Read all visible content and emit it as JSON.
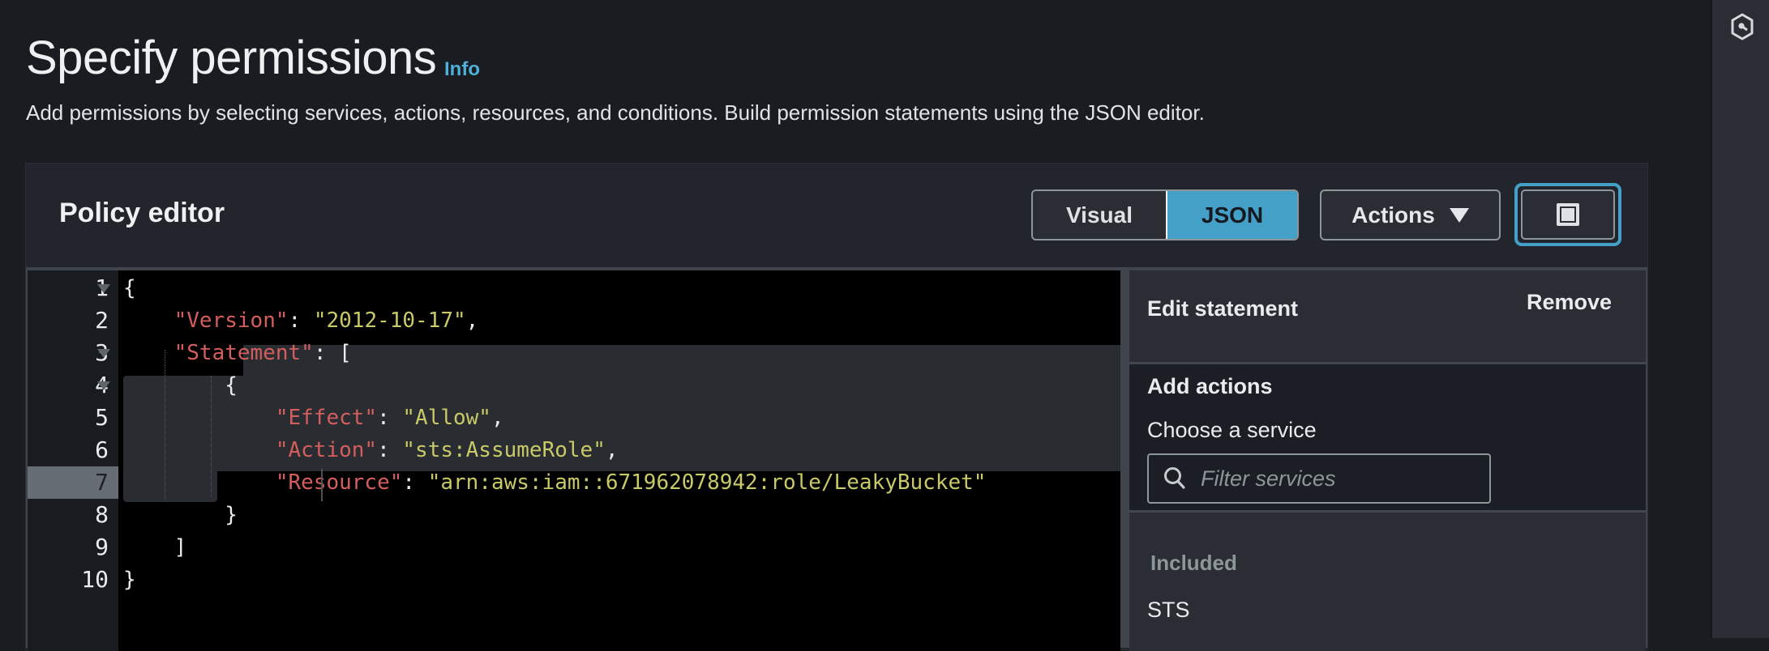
{
  "page": {
    "title": "Specify permissions",
    "info_link": "Info",
    "subtitle": "Add permissions by selecting services, actions, resources, and conditions. Build permission statements using the JSON editor."
  },
  "policy_editor": {
    "title": "Policy editor",
    "mode_toggle": {
      "options": [
        "Visual",
        "JSON"
      ],
      "selected": "JSON"
    },
    "actions_label": "Actions",
    "fullscreen_icon": "fullscreen-icon",
    "colors": {
      "accent": "#44a0c7",
      "json_key": "#d45e5e",
      "json_string": "#c9c968"
    }
  },
  "code_editor": {
    "active_line": 7,
    "line_numbers": [
      "1",
      "2",
      "3",
      "4",
      "5",
      "6",
      "7",
      "8",
      "9",
      "10"
    ],
    "lines": [
      {
        "indent": "",
        "tokens": [
          {
            "t": "p",
            "v": "{"
          }
        ]
      },
      {
        "indent": "    ",
        "tokens": [
          {
            "t": "k",
            "v": "\"Version\""
          },
          {
            "t": "p",
            "v": ": "
          },
          {
            "t": "s",
            "v": "\"2012-10-17\""
          },
          {
            "t": "p",
            "v": ","
          }
        ]
      },
      {
        "indent": "    ",
        "tokens": [
          {
            "t": "k",
            "v": "\"Statement\""
          },
          {
            "t": "p",
            "v": ": ["
          }
        ]
      },
      {
        "indent": "        ",
        "tokens": [
          {
            "t": "p",
            "v": "{"
          }
        ]
      },
      {
        "indent": "            ",
        "tokens": [
          {
            "t": "k",
            "v": "\"Effect\""
          },
          {
            "t": "p",
            "v": ": "
          },
          {
            "t": "s",
            "v": "\"Allow\""
          },
          {
            "t": "p",
            "v": ","
          }
        ]
      },
      {
        "indent": "            ",
        "tokens": [
          {
            "t": "k",
            "v": "\"Action\""
          },
          {
            "t": "p",
            "v": ": "
          },
          {
            "t": "s",
            "v": "\"sts:AssumeRole\""
          },
          {
            "t": "p",
            "v": ","
          }
        ]
      },
      {
        "indent": "            ",
        "tokens": [
          {
            "t": "k",
            "v": "\"Resource\""
          },
          {
            "t": "p",
            "v": ": "
          },
          {
            "t": "s",
            "v": "\"arn:aws:iam::671962078942:role/LeakyBucket\""
          }
        ]
      },
      {
        "indent": "        ",
        "tokens": [
          {
            "t": "p",
            "v": "}"
          }
        ]
      },
      {
        "indent": "    ",
        "tokens": [
          {
            "t": "p",
            "v": "]"
          }
        ]
      },
      {
        "indent": "",
        "tokens": [
          {
            "t": "p",
            "v": "}"
          }
        ]
      }
    ]
  },
  "edit_statement": {
    "title": "Edit statement",
    "remove_label": "Remove",
    "add_actions_title": "Add actions",
    "choose_service_label": "Choose a service",
    "filter_placeholder": "Filter services",
    "filter_value": "",
    "included_label": "Included",
    "included_services": [
      "STS"
    ]
  },
  "right_rail": {
    "icon": "cloudshell-hex-icon"
  }
}
